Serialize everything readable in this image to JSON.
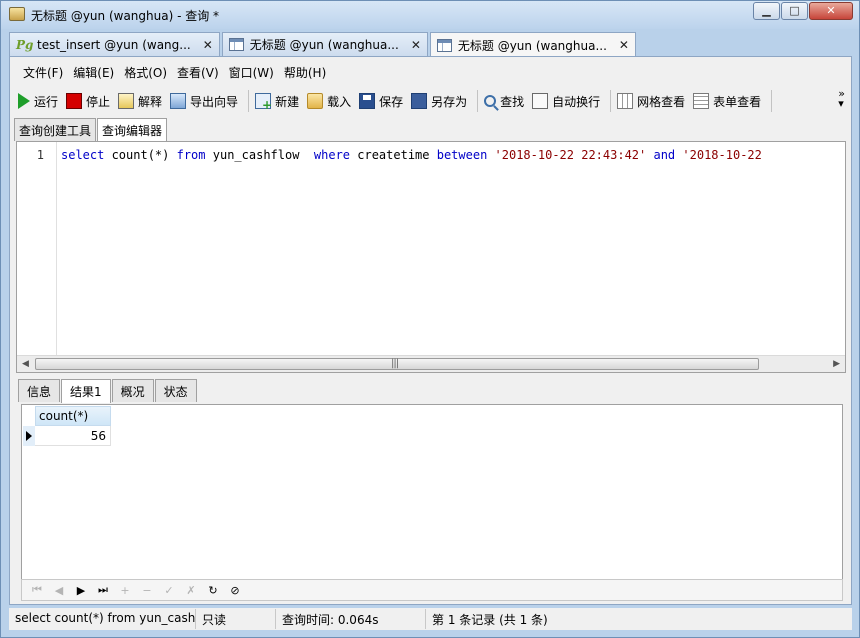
{
  "window": {
    "title": "无标题 @yun (wanghua) - 查询 *"
  },
  "document_tabs": [
    {
      "label": "test_insert @yun (wang...",
      "icon": "postgres-icon",
      "active": false
    },
    {
      "label": "无标题 @yun (wanghua...",
      "icon": "table-icon",
      "active": false
    },
    {
      "label": "无标题 @yun (wanghua...",
      "icon": "table-icon",
      "active": true
    }
  ],
  "menu": [
    "文件(F)",
    "编辑(E)",
    "格式(O)",
    "查看(V)",
    "窗口(W)",
    "帮助(H)"
  ],
  "toolbar": {
    "run": "运行",
    "stop": "停止",
    "explain": "解释",
    "export_wizard": "导出向导",
    "new": "新建",
    "load": "载入",
    "save": "保存",
    "save_as": "另存为",
    "find": "查找",
    "word_wrap": "自动换行",
    "grid_view": "网格查看",
    "form_view": "表单查看"
  },
  "query_tabs": [
    "查询创建工具",
    "查询编辑器"
  ],
  "editor": {
    "line_number": "1",
    "tokens": {
      "kw_select": "select",
      "t1": " count(*) ",
      "kw_from": "from",
      "t2": " yun_cashflow  ",
      "kw_where": "where",
      "t3": " createtime ",
      "kw_between": "between",
      "t4": " ",
      "str1": "'2018-10-22 22:43:42'",
      "t5": " ",
      "kw_and": "and",
      "t6": " ",
      "str2": "'2018-10-22"
    }
  },
  "result_tabs": [
    "信息",
    "结果1",
    "概况",
    "状态"
  ],
  "result": {
    "columns": [
      "count(*)"
    ],
    "rows": [
      [
        "56"
      ]
    ]
  },
  "navigator": [
    "⏮",
    "◀",
    "▶",
    "⏭",
    "+",
    "−",
    "✓",
    "✗",
    "↻",
    "⊘"
  ],
  "status": {
    "sql": "select count(*) from yun_cashflc",
    "mode": "只读",
    "query_time": "查询时间: 0.064s",
    "records": "第 1 条记录 (共 1 条)"
  }
}
